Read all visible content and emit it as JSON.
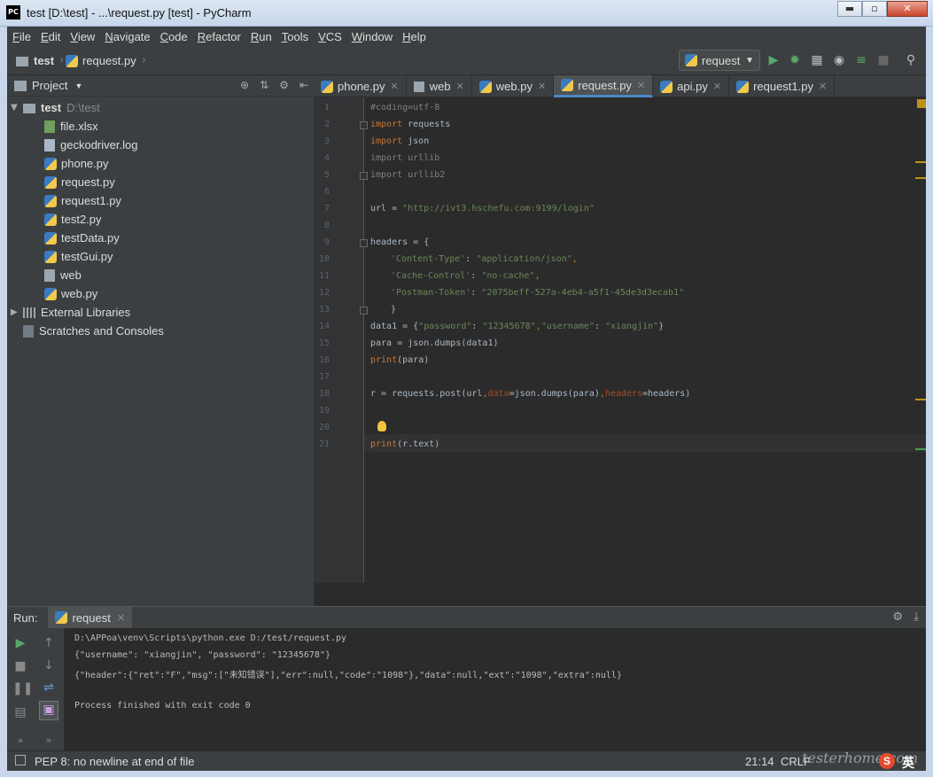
{
  "window": {
    "title": "test [D:\\test] - ...\\request.py [test] - PyCharm",
    "app_icon": "PC",
    "minimize": "▬",
    "maximize": "▫",
    "close": "✕"
  },
  "menu": [
    "File",
    "Edit",
    "View",
    "Navigate",
    "Code",
    "Refactor",
    "Run",
    "Tools",
    "VCS",
    "Window",
    "Help"
  ],
  "breadcrumb": {
    "root": "test",
    "file": "request.py"
  },
  "run_config": {
    "name": "request"
  },
  "project": {
    "header": "Project",
    "root": {
      "name": "test",
      "path": "D:\\test"
    },
    "files": [
      "file.xlsx",
      "geckodriver.log",
      "phone.py",
      "request.py",
      "request1.py",
      "test2.py",
      "testData.py",
      "testGui.py",
      "web",
      "web.py"
    ],
    "external": "External Libraries",
    "scratches": "Scratches and Consoles"
  },
  "tabs": [
    "phone.py",
    "web",
    "web.py",
    "request.py",
    "api.py",
    "request1.py"
  ],
  "active_tab": "request.py",
  "editor": {
    "line_numbers": [
      "1",
      "2",
      "3",
      "4",
      "5",
      "6",
      "7",
      "8",
      "9",
      "10",
      "11",
      "12",
      "13",
      "14",
      "15",
      "16",
      "17",
      "18",
      "19",
      "20",
      "21"
    ],
    "l1": "#coding=utf-8",
    "l2_kw": "import",
    "l2": " requests",
    "l3_kw": "import",
    "l3": " json",
    "l4": "import urllib",
    "l5": "import urllib2",
    "l7a": "url = ",
    "l7s": "\"http://ivt3.hschefu.com:9199/login\"",
    "l9": "headers = {",
    "l10k": "'Content-Type'",
    "l10m": ": ",
    "l10v": "\"application/json\"",
    "l10e": ",",
    "l11k": "'Cache-Control'",
    "l11m": ": ",
    "l11v": "\"no-cache\"",
    "l11e": ",",
    "l12k": "'Postman-Token'",
    "l12m": ": ",
    "l12v": "\"2075beff-527a-4eb4-a5f1-45de3d3ecab1\"",
    "l13": "}",
    "l14a": "data1 = {",
    "l14k1": "\"password\"",
    "l14m1": ": ",
    "l14v1": "\"12345678\"",
    "l14c": ",",
    "l14k2": "\"username\"",
    "l14m2": ": ",
    "l14v2": "\"xiangjin\"",
    "l14e": "}",
    "l15": "para = json.dumps(data1)",
    "l16_kw": "print",
    "l16": "(para)",
    "l18a": "r = requests.post(url",
    "l18b": ",",
    "l18p1": "data",
    "l18c": "=json.dumps(para)",
    "l18d": ",",
    "l18p2": "headers",
    "l18e": "=",
    "l18f": "headers)",
    "l21_kw": "print",
    "l21": "(r.text)"
  },
  "run": {
    "label": "Run:",
    "tab": "request",
    "output": [
      "D:\\APPoa\\venv\\Scripts\\python.exe D:/test/request.py",
      "{\"username\": \"xiangjin\", \"password\": \"12345678\"}",
      "{\"header\":{\"ret\":\"F\",\"msg\":[\"未知错误\"],\"err\":null,\"code\":\"1098\"},\"data\":null,\"ext\":\"1098\",\"extra\":null}",
      "",
      "Process finished with exit code 0"
    ]
  },
  "status": {
    "message": "PEP 8: no newline at end of file",
    "position": "21:14",
    "line_sep": "CRLF",
    "watermark": "testerhome.com",
    "ime": "英"
  },
  "colors": {
    "accent": "#4a88c7",
    "run_green": "#59a869",
    "keyword": "#cc7832",
    "string": "#6a8759"
  }
}
